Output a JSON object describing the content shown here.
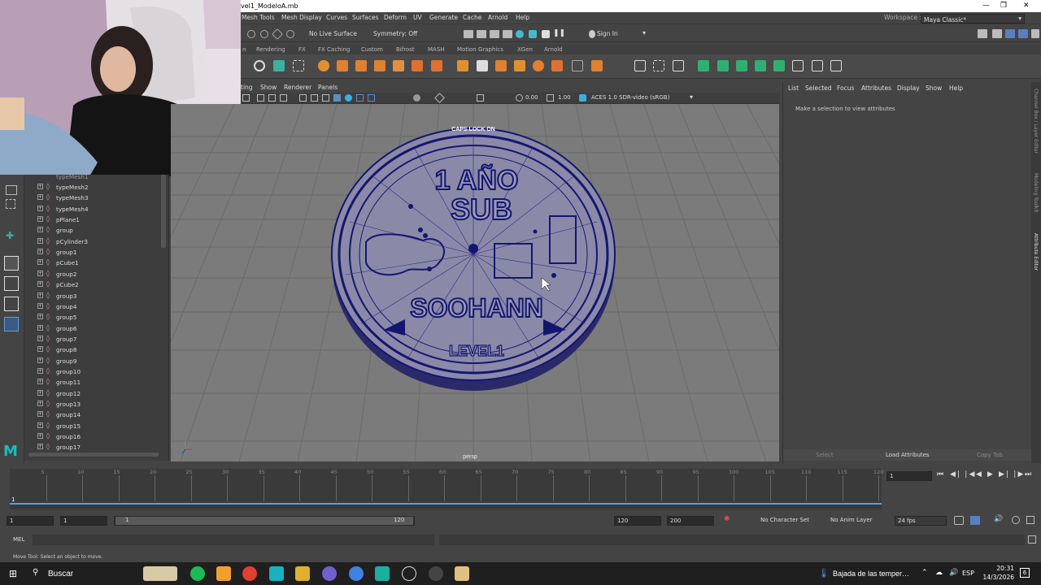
{
  "window": {
    "title": "vel1_ModeloA.mb"
  },
  "menus": [
    "Mesh Tools",
    "Mesh Display",
    "Curves",
    "Surfaces",
    "Deform",
    "UV",
    "Generate",
    "Cache",
    "Arnold",
    "Help"
  ],
  "workspace": {
    "label": "Workspace :",
    "value": "Maya Classic*"
  },
  "status_line": {
    "live_surface": "No Live Surface",
    "symmetry": "Symmetry: Off",
    "sign_in": "Sign In"
  },
  "shelf_tabs": [
    "Rendering",
    "FX",
    "FX Caching",
    "Custom",
    "Bifrost",
    "MASH",
    "Motion Graphics",
    "XGen",
    "Arnold"
  ],
  "viewport": {
    "menu": [
      "Lighting",
      "Show",
      "Renderer",
      "Panels"
    ],
    "menu_display": [
      "ting",
      "Show",
      "Renderer",
      "Panels"
    ],
    "exposure": "0.00",
    "gamma": "1.00",
    "color_space": "ACES 1.0 SDR-video (sRGB)",
    "caps_lock": "CAPS LOCK ON",
    "camera": "persp",
    "coin": {
      "line1": "1 AÑO",
      "line2": "SUB",
      "line3": "SOOHANN",
      "line4": "LEVEL1"
    }
  },
  "outliner": {
    "partial_top": "typeMesh1",
    "items": [
      "typeMesh2",
      "typeMesh3",
      "typeMesh4",
      "pPlane1",
      "group",
      "pCylinder3",
      "group1",
      "pCube1",
      "group2",
      "pCube2",
      "group3",
      "group4",
      "group5",
      "group6",
      "group7",
      "group8",
      "group9",
      "group10",
      "group11",
      "group12",
      "group13",
      "group14",
      "group15",
      "group16",
      "group17"
    ]
  },
  "attribute_editor": {
    "menu": [
      "List",
      "Selected",
      "Focus",
      "Attributes",
      "Display",
      "Show",
      "Help"
    ],
    "message": "Make a selection to view attributes",
    "buttons": {
      "select": "Select",
      "load": "Load Attributes",
      "copy": "Copy Tab"
    },
    "side_tabs": [
      "Channel Box / Layer Editor",
      "Modeling Toolkit",
      "Attribute Editor"
    ]
  },
  "timeline": {
    "ticks": [
      "5",
      "10",
      "15",
      "20",
      "25",
      "30",
      "35",
      "40",
      "45",
      "50",
      "55",
      "60",
      "65",
      "70",
      "75",
      "80",
      "85",
      "90",
      "95",
      "100",
      "105",
      "110",
      "115",
      "120"
    ],
    "current_frame": "1",
    "current_field": "1"
  },
  "range": {
    "start": "1",
    "start2": "1",
    "slider_start": "1",
    "slider_end": "120",
    "end": "120",
    "end2": "200",
    "character_set": "No Character Set",
    "anim_layer": "No Anim Layer",
    "fps": "24 fps"
  },
  "command_line": {
    "lang": "MEL"
  },
  "help_line": "Move Tool: Select an object to move.",
  "taskbar": {
    "search": "Buscar",
    "weather": "Bajada de las temper…",
    "lang": "ESP",
    "time": "20:31",
    "date": "14/3/2026",
    "notif": "6"
  }
}
